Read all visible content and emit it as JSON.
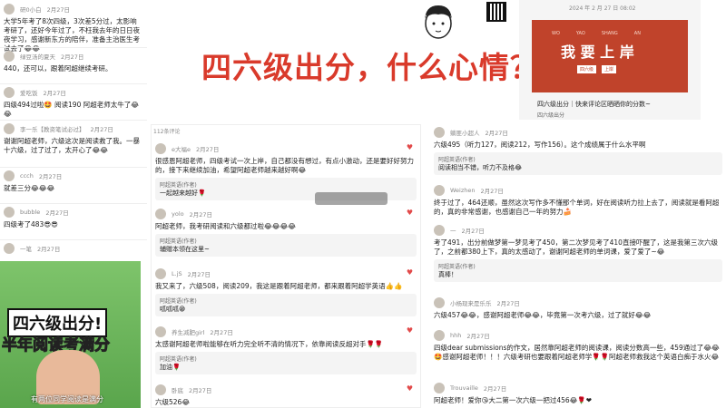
{
  "banner": {
    "text": "四六级出分，什么心情？"
  },
  "left_comments": [
    {
      "user": "研0小白",
      "date": "2月27日",
      "place": "江西",
      "text": "大学5年考了8次四级，3次差5分过，太影响考研了，还好今年过了，不枉我去年的日日夜夜学习，感谢新东方的陪伴，准备主治医生考试去了😂😂"
    },
    {
      "user": "绿豆汤的夏天",
      "date": "2月27日",
      "place": "",
      "text": "440，还可以，跟着阿超继续考研。"
    },
    {
      "user": "爱吃饭",
      "date": "2月27日",
      "place": "",
      "text": "四级494过啦🤩  阅读190  阿超老师太牛了😂😂"
    },
    {
      "user": "李一乐【教资笔试必过】",
      "date": "2月27日",
      "place": "",
      "text": "谢谢阿超老师，六级这次是阅读救了我。一暴十六级，过了过了，太开心了😂😂"
    },
    {
      "user": "ccch",
      "date": "2月27日",
      "place": "山东",
      "text": "就差三分😂😂😂"
    },
    {
      "user": "bubble",
      "date": "2月27日",
      "place": "河南",
      "text": "四级考了483😎😎"
    },
    {
      "user": "一笔",
      "date": "2月27日",
      "place": "四川",
      "text": ""
    }
  ],
  "video_thumb": {
    "line1": "四六级出分!",
    "line2": "半年阅读考满分",
    "caption": "有两位同学阅读是满分"
  },
  "avatar": {
    "label": "cartoon-avatar"
  },
  "qr": {
    "label": "qr-code"
  },
  "poster": {
    "date": "2024 年 2 月 27 日 08:02",
    "pinyin": [
      "WO",
      "YAO",
      "SHANG",
      "AN"
    ],
    "title": "我 要 上 岸",
    "sub1": "四六级",
    "sub2": "上岸",
    "desc": "四六级出分｜快来评论区晒晒你的分数~",
    "desc2": "四六级出分"
  },
  "middle_header": "112条评论",
  "middle_comments": [
    {
      "user": "e大福e",
      "date": "2月27日",
      "likes": "6",
      "text": "很感恩阿超老师，四级考试一次上岸，自己都没有想过，有点小激动，还是要好好努力的，接下来继续加油，希望阿超老师越来越好啊😂",
      "reply": {
        "name": "阿超英语(作者)",
        "text": "一起越来越好🌹"
      }
    },
    {
      "user": "yolo",
      "date": "2月27日",
      "likes": "",
      "text": "阿超老师，我考研阅读和六级都过啦😂😂😂😂",
      "reply": {
        "name": "阿超英语(作者)",
        "text": "辅赠本领在这里~"
      }
    },
    {
      "user": "L.jS",
      "date": "2月27日",
      "likes": "",
      "text": "我又来了，六级508，阅读209，我这是跟着阿超老师，都来跟着阿超学英语👍👍",
      "reply": {
        "name": "阿超英语(作者)",
        "text": "呱呱呱😁"
      }
    },
    {
      "user": "养生减肥girl",
      "date": "2月27日",
      "likes": "",
      "text": "太感谢阿超老师啦能够在听力完全听不清的情况下，依靠阅读反超对手🌹🌹",
      "reply": {
        "name": "阿超英语(作者)",
        "text": "加油🌹"
      }
    },
    {
      "user": "卧底",
      "date": "2月27日",
      "likes": "",
      "text": "六级526😂",
      "reply": null
    }
  ],
  "right_comments": [
    {
      "user": "躺匪小超人",
      "date": "2月27日",
      "text": "六级495（听力127，阅读212，写作156）。这个成绩属于什么水平啊",
      "reply": {
        "name": "阿超英语(作者)",
        "text": "阅读相当不错，听力不及格😂"
      }
    },
    {
      "user": "Weizhen",
      "date": "2月27日",
      "text": "终于过了，464还顺，虽然这次写作多不懂那个单词，好在阅读听力拉上去了，阅读就是看阿超的，真的非常感谢，也感谢自己一年的努力🍰",
      "reply": null
    },
    {
      "user": "一",
      "date": "2月27日",
      "text": "考了491，出分前做梦第一梦见考了450，第二次梦见考了410直接吓醒了，这是我第三次六级了，之前都380上下，真的太感动了，谢谢阿超老师的单词课，爱了爱了~😂",
      "reply": {
        "name": "阿超英语(作者)",
        "text": "真棒！"
      }
    },
    {
      "user": "小杨现来是乐乐",
      "date": "2月27日",
      "text": "六级457😂😂，感谢阿超老师😂😂，毕竟第一次考六级，过了就好😂😂",
      "reply": null
    },
    {
      "user": "hhh",
      "date": "2月27日",
      "text": "四级dear submissions的作文，居然靠阿超老师的阅读课，阅读分数高一些，459通过了😂😂🤩感谢阿超老师！！！六级考研也要跟着阿超老师学🌹🌹阿超老师救我这个英语白痴于水火😂",
      "reply": null
    },
    {
      "user": "Trouvaille",
      "date": "2月27日",
      "text": "阿超老师！爱你😘大二第一次六级一把过456😂🌹❤",
      "reply": null
    }
  ]
}
